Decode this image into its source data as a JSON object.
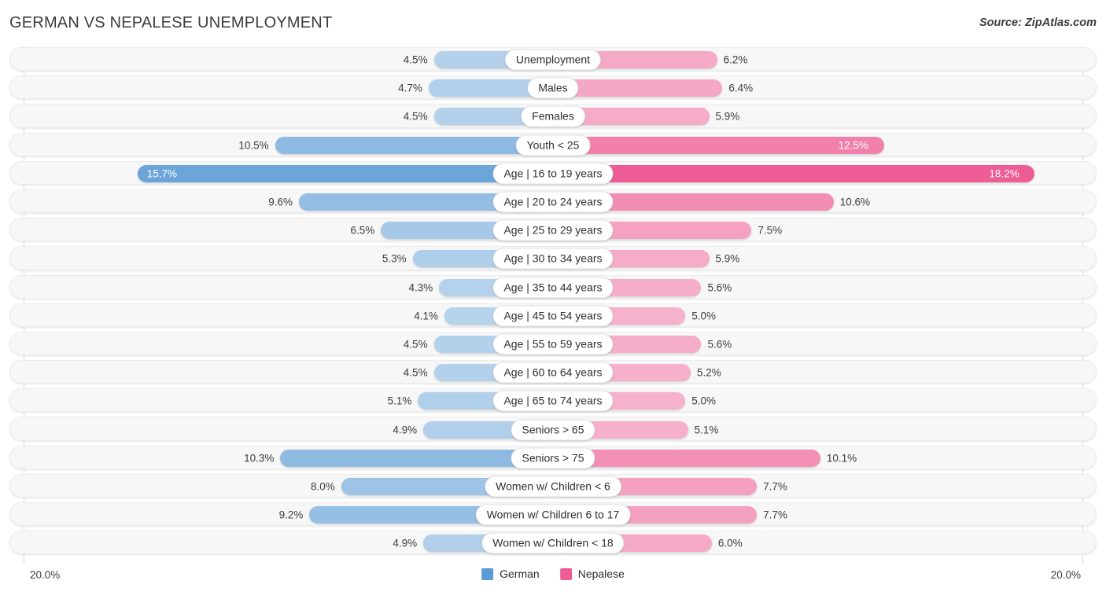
{
  "header": {
    "title": "GERMAN VS NEPALESE UNEMPLOYMENT",
    "source": "Source: ZipAtlas.com"
  },
  "footer": {
    "axis_left": "20.0%",
    "axis_right": "20.0%"
  },
  "legend": {
    "items": [
      {
        "label": "German",
        "color": "#5b9bd5"
      },
      {
        "label": "Nepalese",
        "color": "#ed5c94"
      }
    ]
  },
  "colors": {
    "german_base": "#5b9bd5",
    "nepalese_base": "#ed5c94",
    "track": "#f7f7f7",
    "gridline": "#d9d9d9",
    "text": "#3c3c3c"
  },
  "chart_data": {
    "type": "bar",
    "orientation": "diverging-horizontal",
    "title": "GERMAN VS NEPALESE UNEMPLOYMENT",
    "subtitle": "Source: ZipAtlas.com",
    "xlabel": "",
    "ylabel": "",
    "xlim": [
      -20.0,
      20.0
    ],
    "axis_max": 20.0,
    "unit": "%",
    "grid": false,
    "legend_position": "bottom-center",
    "categories": [
      "Unemployment",
      "Males",
      "Females",
      "Youth < 25",
      "Age | 16 to 19 years",
      "Age | 20 to 24 years",
      "Age | 25 to 29 years",
      "Age | 30 to 34 years",
      "Age | 35 to 44 years",
      "Age | 45 to 54 years",
      "Age | 55 to 59 years",
      "Age | 60 to 64 years",
      "Age | 65 to 74 years",
      "Seniors > 65",
      "Seniors > 75",
      "Women w/ Children < 6",
      "Women w/ Children 6 to 17",
      "Women w/ Children < 18"
    ],
    "series": [
      {
        "name": "German",
        "color": "#5b9bd5",
        "values": [
          4.5,
          4.7,
          4.5,
          10.5,
          15.7,
          9.6,
          6.5,
          5.3,
          4.3,
          4.1,
          4.5,
          4.5,
          5.1,
          4.9,
          10.3,
          8.0,
          9.2,
          4.9
        ],
        "labels": [
          "4.5%",
          "4.7%",
          "4.5%",
          "10.5%",
          "15.7%",
          "9.6%",
          "6.5%",
          "5.3%",
          "4.3%",
          "4.1%",
          "4.5%",
          "4.5%",
          "5.1%",
          "4.9%",
          "10.3%",
          "8.0%",
          "9.2%",
          "4.9%"
        ]
      },
      {
        "name": "Nepalese",
        "color": "#ed5c94",
        "values": [
          6.2,
          6.4,
          5.9,
          12.5,
          18.2,
          10.6,
          7.5,
          5.9,
          5.6,
          5.0,
          5.6,
          5.2,
          5.0,
          5.1,
          10.1,
          7.7,
          7.7,
          6.0
        ],
        "labels": [
          "6.2%",
          "6.4%",
          "5.9%",
          "12.5%",
          "18.2%",
          "10.6%",
          "7.5%",
          "5.9%",
          "5.6%",
          "5.0%",
          "5.6%",
          "5.2%",
          "5.0%",
          "5.1%",
          "10.1%",
          "7.7%",
          "7.7%",
          "6.0%"
        ]
      }
    ]
  }
}
